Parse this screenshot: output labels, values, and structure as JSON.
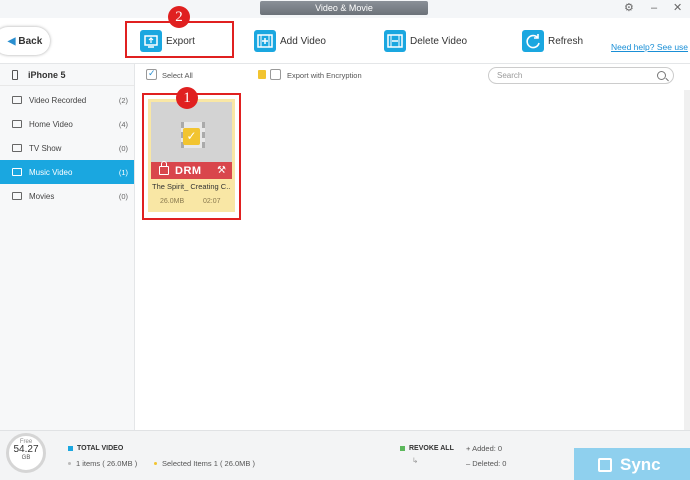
{
  "window": {
    "title": "Video & Movie",
    "icons": [
      "settings-icon",
      "minimize-icon",
      "close-icon"
    ]
  },
  "toolbar": {
    "back_label": "Back",
    "buttons": [
      {
        "label": "Export",
        "icon": "export-icon"
      },
      {
        "label": "Add Video",
        "icon": "add-video-icon"
      },
      {
        "label": "Delete Video",
        "icon": "delete-video-icon"
      },
      {
        "label": "Refresh",
        "icon": "refresh-icon"
      }
    ],
    "help_link": "Need help? See use"
  },
  "sidebar": {
    "device": "iPhone 5",
    "items": [
      {
        "label": "Video Recorded",
        "count": "(2)"
      },
      {
        "label": "Home Video",
        "count": "(4)"
      },
      {
        "label": "TV Show",
        "count": "(0)"
      },
      {
        "label": "Music Video",
        "count": "(1)",
        "active": true
      },
      {
        "label": "Movies",
        "count": "(0)"
      }
    ],
    "active_color": "#1aa7e0"
  },
  "filterbar": {
    "select_all": "Select All",
    "export_encryption": "Export with Encryption",
    "search_placeholder": "Search"
  },
  "video": {
    "drm_label": "DRM",
    "title": "The Spirit_ Creating C...",
    "size": "26.0MB",
    "duration": "02:07"
  },
  "callouts": {
    "one": "1",
    "two": "2"
  },
  "footer": {
    "free_label": "Free",
    "free_value": "54.27",
    "free_unit": "GB",
    "total_label": "TOTAL VIDEO",
    "total_items": "1 items ( 26.0MB )",
    "selected_items": "Selected Items 1 ( 26.0MB )",
    "revoke_label": "REVOKE ALL",
    "added": "Added: 0",
    "deleted": "Deleted: 0",
    "sync_label": "Sync"
  }
}
